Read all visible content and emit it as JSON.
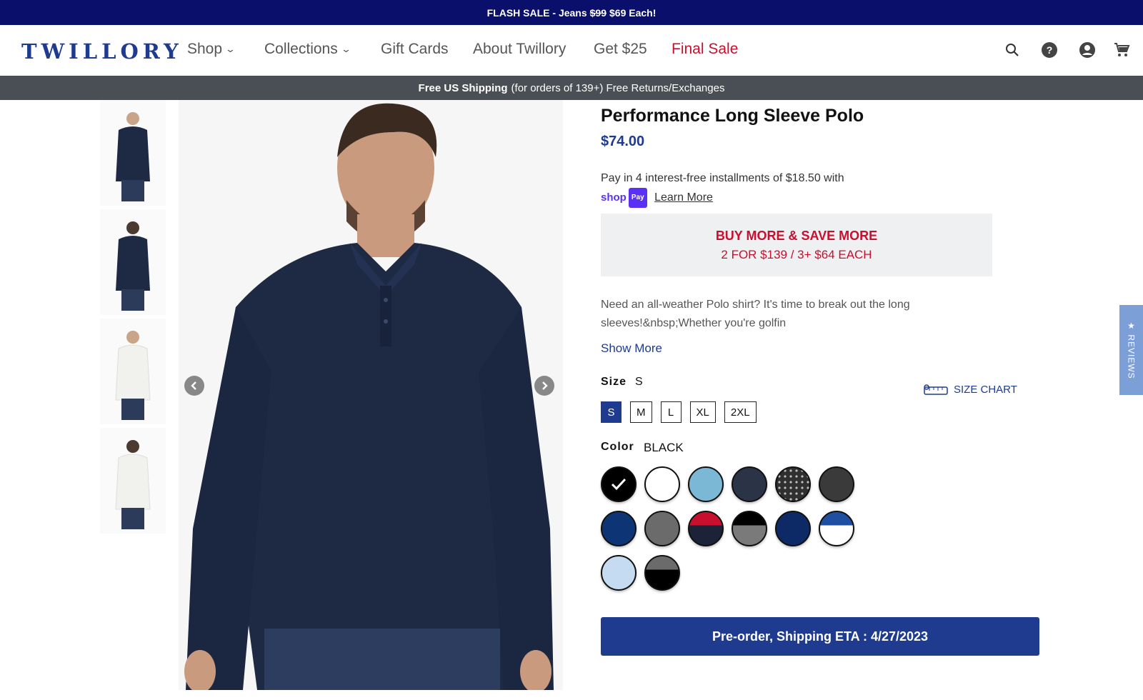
{
  "flash": {
    "prefix": "FLASH SALE - Jeans",
    "old_price": "$99",
    "suffix": "$69 Each!"
  },
  "nav": {
    "logo": "TWILLORY",
    "items": [
      {
        "label": "Shop"
      },
      {
        "label": "Collections"
      },
      {
        "label": "Gift Cards"
      },
      {
        "label": "About Twillory"
      },
      {
        "label": "Get $25"
      },
      {
        "label": "Final Sale"
      }
    ],
    "icons": [
      "search-icon",
      "help-icon",
      "account-icon",
      "cart-icon"
    ]
  },
  "shipping": {
    "bold": "Free US Shipping",
    "rest": "(for orders of 139+) Free Returns/Exchanges"
  },
  "product": {
    "title": "Performance Long Sleeve Polo",
    "price": "$74.00",
    "installments": "Pay in 4 interest-free installments of $18.50 with",
    "shoppay_brand": "shop",
    "shoppay_pill": "Pay",
    "learn_more": "Learn More",
    "promo_line1": "BUY MORE & SAVE MORE",
    "promo_line2": "2 FOR $139 / 3+ $64 EACH",
    "description": "Need an all-weather Polo shirt? It's time to break out the long sleeves!&nbsp;Whether you're golfin",
    "show_more": "Show More",
    "size_label": "Size",
    "size_selected": "S",
    "size_chart": "SIZE CHART",
    "sizes": [
      "S",
      "M",
      "L",
      "XL",
      "2XL"
    ],
    "color_label": "Color",
    "color_selected": "BLACK",
    "cta": "Pre-order, Shipping ETA : 4/27/2023"
  },
  "colors": {
    "brand": "#1f3b8f",
    "sale_red": "#c8102e",
    "flash_bg": "#0a0f6b",
    "swatches": [
      {
        "top": "#000000",
        "bottom": "#000000",
        "selected": true
      },
      {
        "top": "#ffffff",
        "bottom": "#ffffff"
      },
      {
        "top": "#7ab8d6",
        "bottom": "#7ab8d6"
      },
      {
        "top": "#2b3347",
        "bottom": "#2b3347"
      },
      {
        "top": "#2f2f2f",
        "bottom": "#2f2f2f",
        "pattern": "dots"
      },
      {
        "top": "#3a3a3a",
        "bottom": "#3a3a3a"
      },
      {
        "top": "#0d3575",
        "bottom": "#0d3575"
      },
      {
        "top": "#6b6b6b",
        "bottom": "#6b6b6b"
      },
      {
        "top": "#c8102e",
        "bottom": "#1c2237"
      },
      {
        "top": "#000000",
        "bottom": "#7a7a7a"
      },
      {
        "top": "#0d2a66",
        "bottom": "#0d2a66"
      },
      {
        "top": "#1f4fa0",
        "bottom": "#ffffff"
      },
      {
        "top": "#c4dbf2",
        "bottom": "#c4dbf2"
      },
      {
        "top": "#6b6b6b",
        "bottom": "#000000"
      }
    ]
  },
  "reviews_tab": "★ REVIEWS"
}
